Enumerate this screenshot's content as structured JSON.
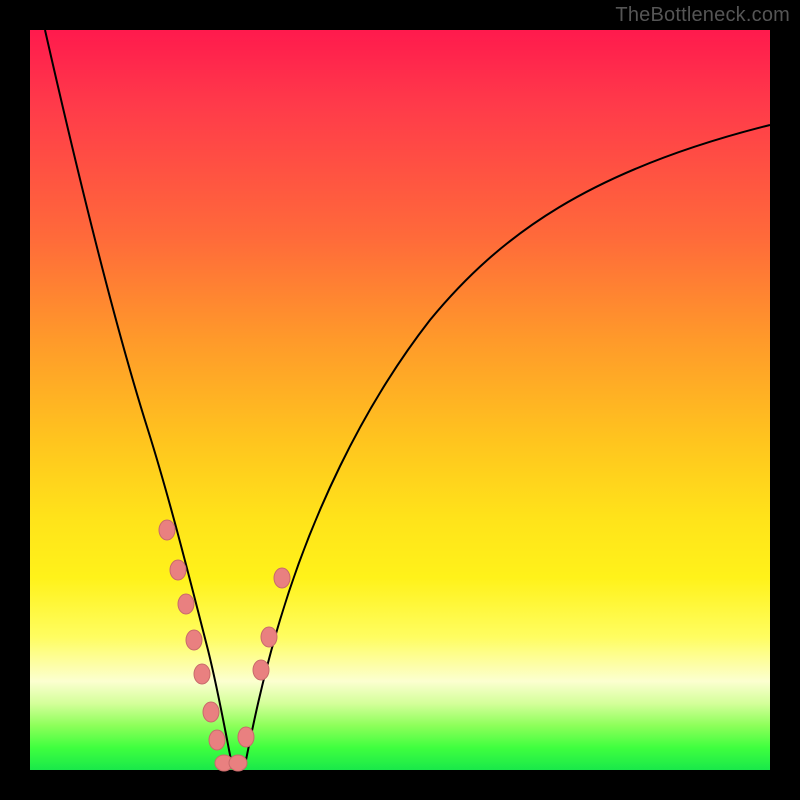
{
  "watermark": "TheBottleneck.com",
  "chart_data": {
    "type": "line",
    "title": "",
    "xlabel": "",
    "ylabel": "",
    "xlim": [
      0,
      1
    ],
    "ylim": [
      0,
      1
    ],
    "note": "Axes are unlabeled in the source image; x and y are normalized 0–1. Lower y = closer to optimal (green). Curve is a V-shaped bottleneck profile with minimum near x≈0.27.",
    "series": [
      {
        "name": "bottleneck-curve",
        "x": [
          0.0,
          0.05,
          0.1,
          0.14,
          0.17,
          0.2,
          0.22,
          0.24,
          0.255,
          0.27,
          0.285,
          0.3,
          0.33,
          0.37,
          0.43,
          0.5,
          0.6,
          0.72,
          0.85,
          1.0
        ],
        "y": [
          1.0,
          0.82,
          0.63,
          0.48,
          0.37,
          0.27,
          0.19,
          0.12,
          0.05,
          0.0,
          0.04,
          0.1,
          0.19,
          0.32,
          0.47,
          0.6,
          0.72,
          0.81,
          0.86,
          0.88
        ]
      }
    ],
    "markers": {
      "name": "highlighted-points",
      "x": [
        0.185,
        0.2,
        0.21,
        0.222,
        0.232,
        0.244,
        0.252,
        0.262,
        0.28,
        0.292,
        0.312,
        0.322,
        0.34
      ],
      "y": [
        0.325,
        0.27,
        0.225,
        0.175,
        0.13,
        0.078,
        0.04,
        0.01,
        0.01,
        0.045,
        0.135,
        0.18,
        0.26
      ]
    },
    "gradient_stops": [
      {
        "pos": 0.0,
        "color": "#ff1a4d"
      },
      {
        "pos": 0.28,
        "color": "#ff6a3a"
      },
      {
        "pos": 0.56,
        "color": "#ffc61e"
      },
      {
        "pos": 0.82,
        "color": "#fffd60"
      },
      {
        "pos": 0.94,
        "color": "#8dff5a"
      },
      {
        "pos": 1.0,
        "color": "#19e84a"
      }
    ]
  }
}
